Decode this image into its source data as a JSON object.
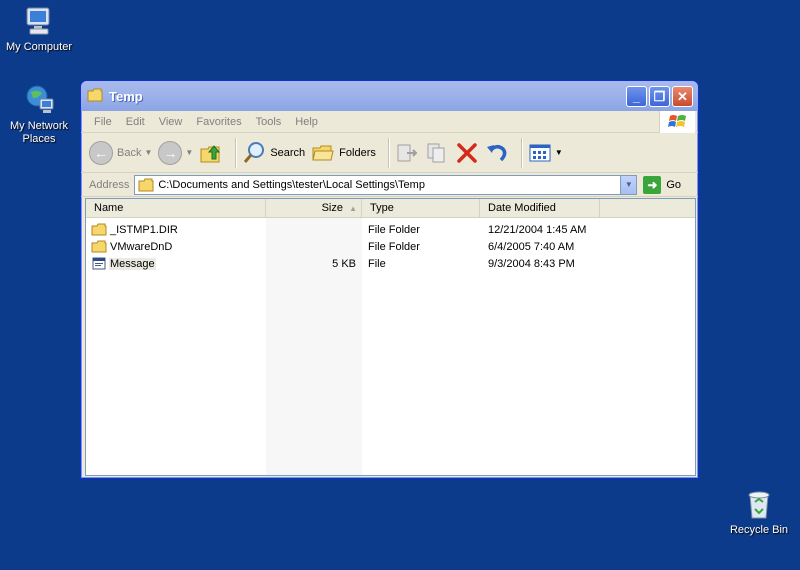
{
  "desktop": {
    "icons": [
      {
        "label": "My Computer"
      },
      {
        "label": "My Network Places"
      },
      {
        "label": "Recycle Bin"
      }
    ]
  },
  "window": {
    "title": "Temp",
    "menu": [
      "File",
      "Edit",
      "View",
      "Favorites",
      "Tools",
      "Help"
    ],
    "toolbar": {
      "back": "Back",
      "search": "Search",
      "folders": "Folders"
    },
    "address": {
      "label": "Address",
      "value": "C:\\Documents and Settings\\tester\\Local Settings\\Temp",
      "go": "Go"
    },
    "columns": [
      "Name",
      "Size",
      "Type",
      "Date Modified"
    ],
    "files": [
      {
        "name": "_ISTMP1.DIR",
        "size": "",
        "type": "File Folder",
        "date": "12/21/2004 1:45 AM",
        "icon": "folder-icon"
      },
      {
        "name": "VMwareDnD",
        "size": "",
        "type": "File Folder",
        "date": "6/4/2005 7:40 AM",
        "icon": "folder-icon"
      },
      {
        "name": "Message",
        "size": "5 KB",
        "type": "File",
        "date": "9/3/2004 8:43 PM",
        "icon": "file-icon"
      }
    ]
  },
  "colors": {
    "desktop": "#0c3b8c",
    "titlebar": "#9fb4ec",
    "close": "#c94a2d"
  }
}
